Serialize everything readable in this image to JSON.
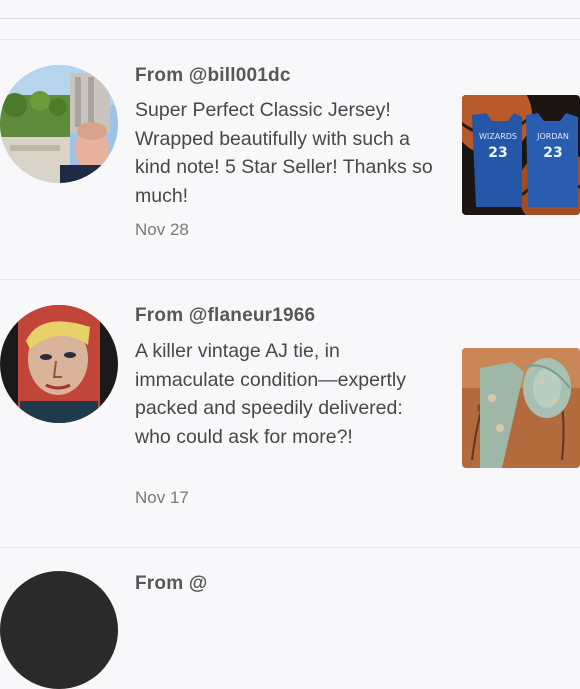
{
  "reviews": [
    {
      "from": "From @bill001dc",
      "text": "Super Perfect Classic Jersey! Wrapped beautifully with such a kind note! 5 Star Seller! Thanks so much!",
      "date": "Nov 28",
      "jersey_labels": [
        "WIZARDS",
        "JORDAN"
      ],
      "jersey_numbers": [
        "23",
        "23"
      ]
    },
    {
      "from": "From @flaneur1966",
      "text": "A killer vintage AJ tie, in immaculate condition—expertly packed and speedily delivered: who could ask for more?!",
      "date": "Nov 17"
    },
    {
      "from": "From @"
    }
  ],
  "colors": {
    "background": "#f8f7f9",
    "separator": "#e6e3e8",
    "username_text": "#5a5658",
    "body_text": "#4a4648",
    "date_text": "#7b777a",
    "jersey_blue": "#2457a8"
  }
}
